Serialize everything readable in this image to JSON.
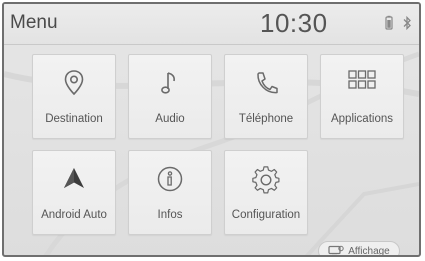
{
  "header": {
    "title": "Menu",
    "clock": "10:30",
    "status_icons": [
      "phone-battery-icon",
      "bluetooth-icon"
    ]
  },
  "tiles": [
    {
      "label": "Destination",
      "icon": "map-pin-icon"
    },
    {
      "label": "Audio",
      "icon": "music-note-icon"
    },
    {
      "label": "Téléphone",
      "icon": "phone-icon"
    },
    {
      "label": "Applications",
      "icon": "app-grid-icon"
    },
    {
      "label": "Android Auto",
      "icon": "android-auto-icon"
    },
    {
      "label": "Infos",
      "icon": "info-icon"
    },
    {
      "label": "Configuration",
      "icon": "gear-icon"
    }
  ],
  "display_button": {
    "label": "Affichage",
    "icon": "display-icon"
  },
  "colors": {
    "icon": "#6a6a6a",
    "android_auto": "#3c3c3c",
    "text": "#555555"
  }
}
